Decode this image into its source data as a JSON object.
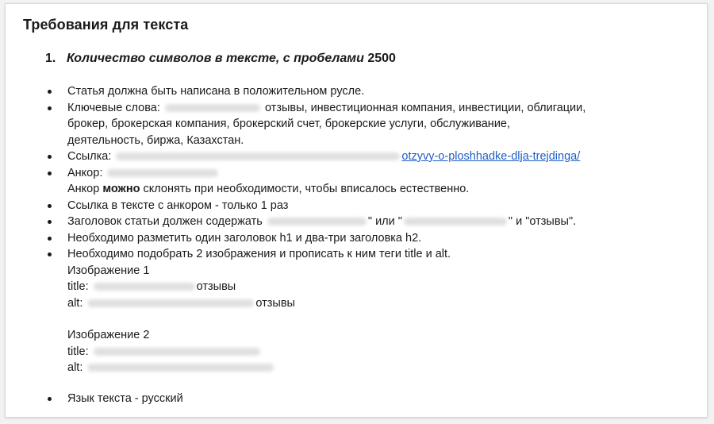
{
  "doc": {
    "title": "Требования для текста",
    "section": {
      "number": "1.",
      "label_italic": "Количество символов в тексте, с пробелами",
      "value": "2500"
    },
    "items": {
      "positive": "Статья должна быть написана в положительном русле.",
      "keywords_label": "Ключевые слова:",
      "keywords_line1": "отзывы, инвестиционная компания, инвестиции, облигации,",
      "keywords_line2": "брокер, брокерская компания, брокерский счет, брокерские услуги, обслуживание,",
      "keywords_line3": "деятельность, биржа, Казахстан.",
      "link_label": "Ссылка:",
      "link_text": "otzyvy-o-ploshhadke-dlja-trejdinga/",
      "anchor_label": "Анкор:",
      "anchor_note_pre": "Анкор",
      "anchor_note_bold": "можно",
      "anchor_note_post": "склонять при необходимости, чтобы вписалось естественно.",
      "anchor_once": "Ссылка в тексте с анкором - только 1 раз",
      "heading_req_pre": "Заголовок статьи должен содержать",
      "heading_req_q1": "\" или \"",
      "heading_req_q2": "\" и \"отзывы\".",
      "h_tags": "Необходимо разметить один заголовок h1 и два-три заголовка h2.",
      "images_req": "Необходимо подобрать 2 изображения и прописать к ним теги title и alt.",
      "img1_label": "Изображение 1",
      "img1_title_label": "title:",
      "img1_title_value": "отзывы",
      "img1_alt_label": "alt:",
      "img1_alt_value": "отзывы",
      "img2_label": "Изображение 2",
      "img2_title_label": "title:",
      "img2_alt_label": "alt:",
      "language": "Язык текста - русский"
    }
  }
}
